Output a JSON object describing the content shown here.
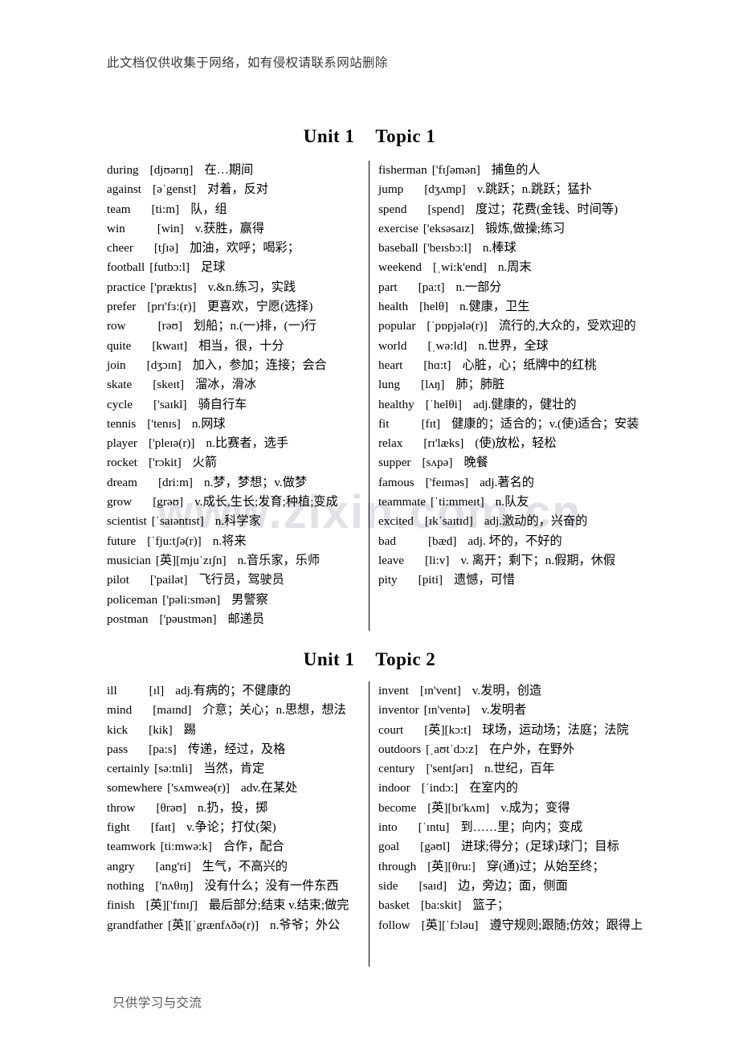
{
  "document": {
    "header_note": "此文档仅供收集于网络，如有侵权请联系网站删除",
    "footer_note": "只供学习与交流",
    "watermark": "www.zixin.com.cn"
  },
  "sections": [
    {
      "id": "unit1-topic1",
      "title_unit": "Unit 1",
      "title_topic": "Topic 1",
      "left_column": [
        {
          "word": "during",
          "phonetic": "[djʊərɪŋ]",
          "definition": "在…期间"
        },
        {
          "word": "against",
          "phonetic": "[əˈgenst]",
          "definition": "对着，反对"
        },
        {
          "word": "team",
          "phonetic": "[ti:m]",
          "definition": "队，组"
        },
        {
          "word": "win",
          "phonetic": "[win]",
          "definition": "v.获胜，赢得"
        },
        {
          "word": "cheer",
          "phonetic": "[tʃɪə]",
          "definition": "加油，欢呼；喝彩；"
        },
        {
          "word": "football",
          "phonetic": "[futbɔ:l]",
          "definition": "足球"
        },
        {
          "word": "practice",
          "phonetic": "['præktɪs]",
          "definition": "v.&n.练习，实践"
        },
        {
          "word": "prefer",
          "phonetic": "[prɪ'fɜ:(r)]",
          "definition": "更喜欢，宁愿(选择)"
        },
        {
          "word": "row",
          "phonetic": "[rəʊ]",
          "definition": "划船；n.(一)排，(一)行"
        },
        {
          "word": "quite",
          "phonetic": "[kwaɪt]",
          "definition": "相当，很，十分"
        },
        {
          "word": "join",
          "phonetic": "[dʒɔɪn]",
          "definition": "加入，参加；连接；会合"
        },
        {
          "word": "skate",
          "phonetic": "[skeɪt]",
          "definition": "溜冰，滑冰"
        },
        {
          "word": "cycle",
          "phonetic": "['saɪkl]",
          "definition": "骑自行车"
        },
        {
          "word": "tennis",
          "phonetic": "['tenɪs]",
          "definition": "n.网球"
        },
        {
          "word": "player",
          "phonetic": "['pleɪə(r)]",
          "definition": "n.比赛者，选手"
        },
        {
          "word": "rocket",
          "phonetic": "['rɔkit]",
          "definition": "火箭"
        },
        {
          "word": "dream",
          "phonetic": "[dri:m]",
          "definition": "n.梦，梦想；v.做梦"
        },
        {
          "word": "grow",
          "phonetic": "[grəʊ]",
          "definition": "v.成长,生长;发育;种植;变成"
        },
        {
          "word": "scientist",
          "phonetic": "[ˈsaɪəntɪst]",
          "definition": "n.科学家"
        },
        {
          "word": "future",
          "phonetic": "[ˈfju:tʃə(r)]",
          "definition": "n.将来"
        },
        {
          "word": "musician",
          "phonetic": "[英][mjuˈzɪʃn]",
          "definition": "n.音乐家，乐师"
        },
        {
          "word": "pilot",
          "phonetic": "['pailət]",
          "definition": "飞行员，驾驶员"
        },
        {
          "word": "policeman",
          "phonetic": "['pəli:smən]",
          "definition": "男警察"
        },
        {
          "word": "postman",
          "phonetic": "['pəustmən]",
          "definition": "邮递员"
        }
      ],
      "right_column": [
        {
          "word": "fisherman",
          "phonetic": "['fɪʃəmən]",
          "definition": "捕鱼的人"
        },
        {
          "word": "jump",
          "phonetic": "[dʒʌmp]",
          "definition": "v.跳跃；n.跳跃；猛扑"
        },
        {
          "word": "spend",
          "phonetic": "[spend]",
          "definition": "度过；花费(金钱、时间等)"
        },
        {
          "word": "exercise",
          "phonetic": "['eksəsaɪz]",
          "definition": "锻炼,做操;练习"
        },
        {
          "word": "baseball",
          "phonetic": "['beɪsbɔ:l]",
          "definition": "n.棒球"
        },
        {
          "word": "weekend",
          "phonetic": "[ˌwi:k'end]",
          "definition": "n.周末"
        },
        {
          "word": "part",
          "phonetic": "[pa:t]",
          "definition": "n.一部分"
        },
        {
          "word": "health",
          "phonetic": "[helθ]",
          "definition": "n.健康，卫生"
        },
        {
          "word": "popular",
          "phonetic": "[ˈpɒpjələ(r)]",
          "definition": "流行的,大众的，受欢迎的"
        },
        {
          "word": "world",
          "phonetic": "[ˌwə:ld]",
          "definition": "n.世界，全球"
        },
        {
          "word": "heart",
          "phonetic": "[hɑ:t]",
          "definition": "心脏，心；纸牌中的红桃"
        },
        {
          "word": "lung",
          "phonetic": "[lʌŋ]",
          "definition": "肺；肺脏"
        },
        {
          "word": "healthy",
          "phonetic": "[ˈhelθi]",
          "definition": "adj.健康的，健壮的"
        },
        {
          "word": "fit",
          "phonetic": "[fɪt]",
          "definition": "健康的；适合的；v.(使)适合；安装"
        },
        {
          "word": "relax",
          "phonetic": "[rɪ'læks]",
          "definition": "(使)放松，轻松"
        },
        {
          "word": "supper",
          "phonetic": "[sʌpə]",
          "definition": "晚餐"
        },
        {
          "word": "famous",
          "phonetic": "['feɪməs]",
          "definition": "adj.著名的"
        },
        {
          "word": "teammate",
          "phonetic": "[ˈti:mmeɪt]",
          "definition": "n.队友"
        },
        {
          "word": "excited",
          "phonetic": "[ɪkˈsaɪtɪd]",
          "definition": "adj.激动的，兴奋的"
        },
        {
          "word": "bad",
          "phonetic": "[bæd]",
          "definition": "adj. 坏的，不好的"
        },
        {
          "word": "leave",
          "phonetic": "[li:v]",
          "definition": "v. 离开；剩下；n.假期，休假"
        },
        {
          "word": "pity",
          "phonetic": "[piti]",
          "definition": "遗憾，可惜"
        }
      ]
    },
    {
      "id": "unit1-topic2",
      "title_unit": "Unit 1",
      "title_topic": "Topic 2",
      "left_column": [
        {
          "word": "ill",
          "phonetic": "[ɪl]",
          "definition": "adj.有病的；不健康的"
        },
        {
          "word": "mind",
          "phonetic": "[maɪnd]",
          "definition": "介意；关心；n.思想，想法"
        },
        {
          "word": "kick",
          "phonetic": "[kik]",
          "definition": "踢"
        },
        {
          "word": "pass",
          "phonetic": "[pa:s]",
          "definition": "传递，经过，及格"
        },
        {
          "word": "certainly",
          "phonetic": "[sə:tnli]",
          "definition": "当然，肯定"
        },
        {
          "word": "somewhere",
          "phonetic": "['sʌmweə(r)]",
          "definition": "adv.在某处"
        },
        {
          "word": "throw",
          "phonetic": "[θrəʊ]",
          "definition": "n.扔，投，掷"
        },
        {
          "word": "fight",
          "phonetic": "[faɪt]",
          "definition": "v.争论；打仗(架)"
        },
        {
          "word": "teamwork",
          "phonetic": "[ti:mwə:k]",
          "definition": "合作，配合"
        },
        {
          "word": "angry",
          "phonetic": "[ang'ri]",
          "definition": "生气，不高兴的"
        },
        {
          "word": "nothing",
          "phonetic": "['nʌθɪŋ]",
          "definition": "没有什么；没有一件东西"
        },
        {
          "word": "finish",
          "phonetic": "[英]['fɪnɪʃ]",
          "definition": "最后部分;结束 v.结束;做完"
        },
        {
          "word": "grandfather",
          "phonetic": "[英][ˈgrænfʌðə(r)]",
          "definition": "n.爷爷；外公"
        }
      ],
      "right_column": [
        {
          "word": "invent",
          "phonetic": "[ɪn'vent]",
          "definition": "v.发明，创造"
        },
        {
          "word": "inventor",
          "phonetic": "[ɪn'ventə]",
          "definition": "v.发明者"
        },
        {
          "word": "court",
          "phonetic": "[英][kɔ:t]",
          "definition": "球场，运动场；法庭；法院"
        },
        {
          "word": "outdoors",
          "phonetic": "[ˌaʊtˈdɔ:z]",
          "definition": "在户外，在野外"
        },
        {
          "word": "century",
          "phonetic": "['sentʃərɪ]",
          "definition": "n.世纪，百年"
        },
        {
          "word": "indoor",
          "phonetic": "[ˈindɔ:]",
          "definition": "在室内的"
        },
        {
          "word": "become",
          "phonetic": "[英][bɪ'kʌm]",
          "definition": "v.成为；变得"
        },
        {
          "word": "into",
          "phonetic": "[ˈɪntu]",
          "definition": "到……里；向内；变成"
        },
        {
          "word": "goal",
          "phonetic": "[gəʊl]",
          "definition": "进球;得分；(足球)球门；目标"
        },
        {
          "word": "through",
          "phonetic": "[英][θru:]",
          "definition": "穿(通)过；从始至终；"
        },
        {
          "word": "side",
          "phonetic": "[saɪd]",
          "definition": "边，旁边；面，侧面"
        },
        {
          "word": "basket",
          "phonetic": "[ba:skit]",
          "definition": "篮子；"
        },
        {
          "word": "follow",
          "phonetic": "[英][ˈfɔləu]",
          "definition": "遵守规则;跟随;仿效；跟得上"
        }
      ]
    }
  ]
}
